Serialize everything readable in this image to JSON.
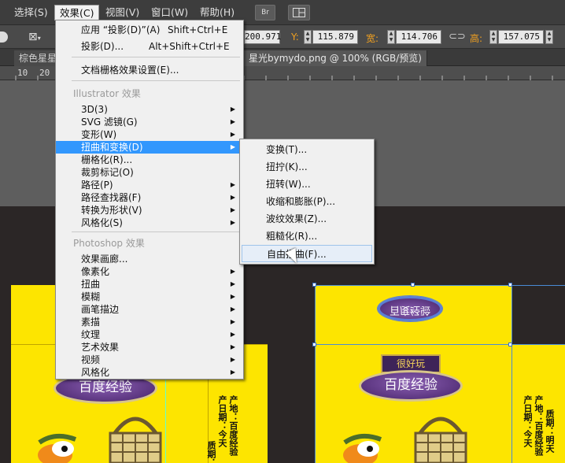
{
  "menubar": {
    "items": [
      {
        "label": "选择(S)"
      },
      {
        "label": "效果(C)"
      },
      {
        "label": "视图(V)"
      },
      {
        "label": "窗口(W)"
      },
      {
        "label": "帮助(H)"
      }
    ],
    "br_label": "Br"
  },
  "controlbar": {
    "x_value": "200.971",
    "y_label": "Y:",
    "y_value": "115.879",
    "w_label": "宽:",
    "w_value": "114.706",
    "h_label": "高:",
    "h_value": "157.075"
  },
  "tabs": [
    {
      "label": "棕色星星"
    },
    {
      "label": "星光bymydo.png @ 100% (RGB/预览)"
    }
  ],
  "ruler": {
    "ticks": [
      "10",
      "20"
    ]
  },
  "effect_menu": {
    "apply_last": {
      "label": "应用 “投影(D)”(A)",
      "shortcut": "Shift+Ctrl+E"
    },
    "last_effect": {
      "label": "投影(D)...",
      "shortcut": "Alt+Shift+Ctrl+E"
    },
    "doc_raster": "文档栅格效果设置(E)...",
    "illustrator_section": "Illustrator 效果",
    "illustrator_items": [
      "3D(3)",
      "SVG 滤镜(G)",
      "变形(W)",
      "扭曲和变换(D)",
      "栅格化(R)...",
      "裁剪标记(O)",
      "路径(P)",
      "路径查找器(F)",
      "转换为形状(V)",
      "风格化(S)"
    ],
    "photoshop_section": "Photoshop 效果",
    "photoshop_items": [
      "效果画廊...",
      "像素化",
      "扭曲",
      "模糊",
      "画笔描边",
      "素描",
      "纹理",
      "艺术效果",
      "视频",
      "风格化"
    ]
  },
  "distort_submenu": {
    "items": [
      "变换(T)...",
      "扭拧(K)...",
      "扭转(W)...",
      "收缩和膨胀(P)...",
      "波纹效果(Z)...",
      "粗糙化(R)...",
      "自由扭曲(F)..."
    ]
  },
  "artwork": {
    "badge_text": "百度经验",
    "tag_text": "很好玩",
    "info_lines": [
      "产日期：今天",
      "产地：百度经验",
      "质期：明天"
    ]
  }
}
